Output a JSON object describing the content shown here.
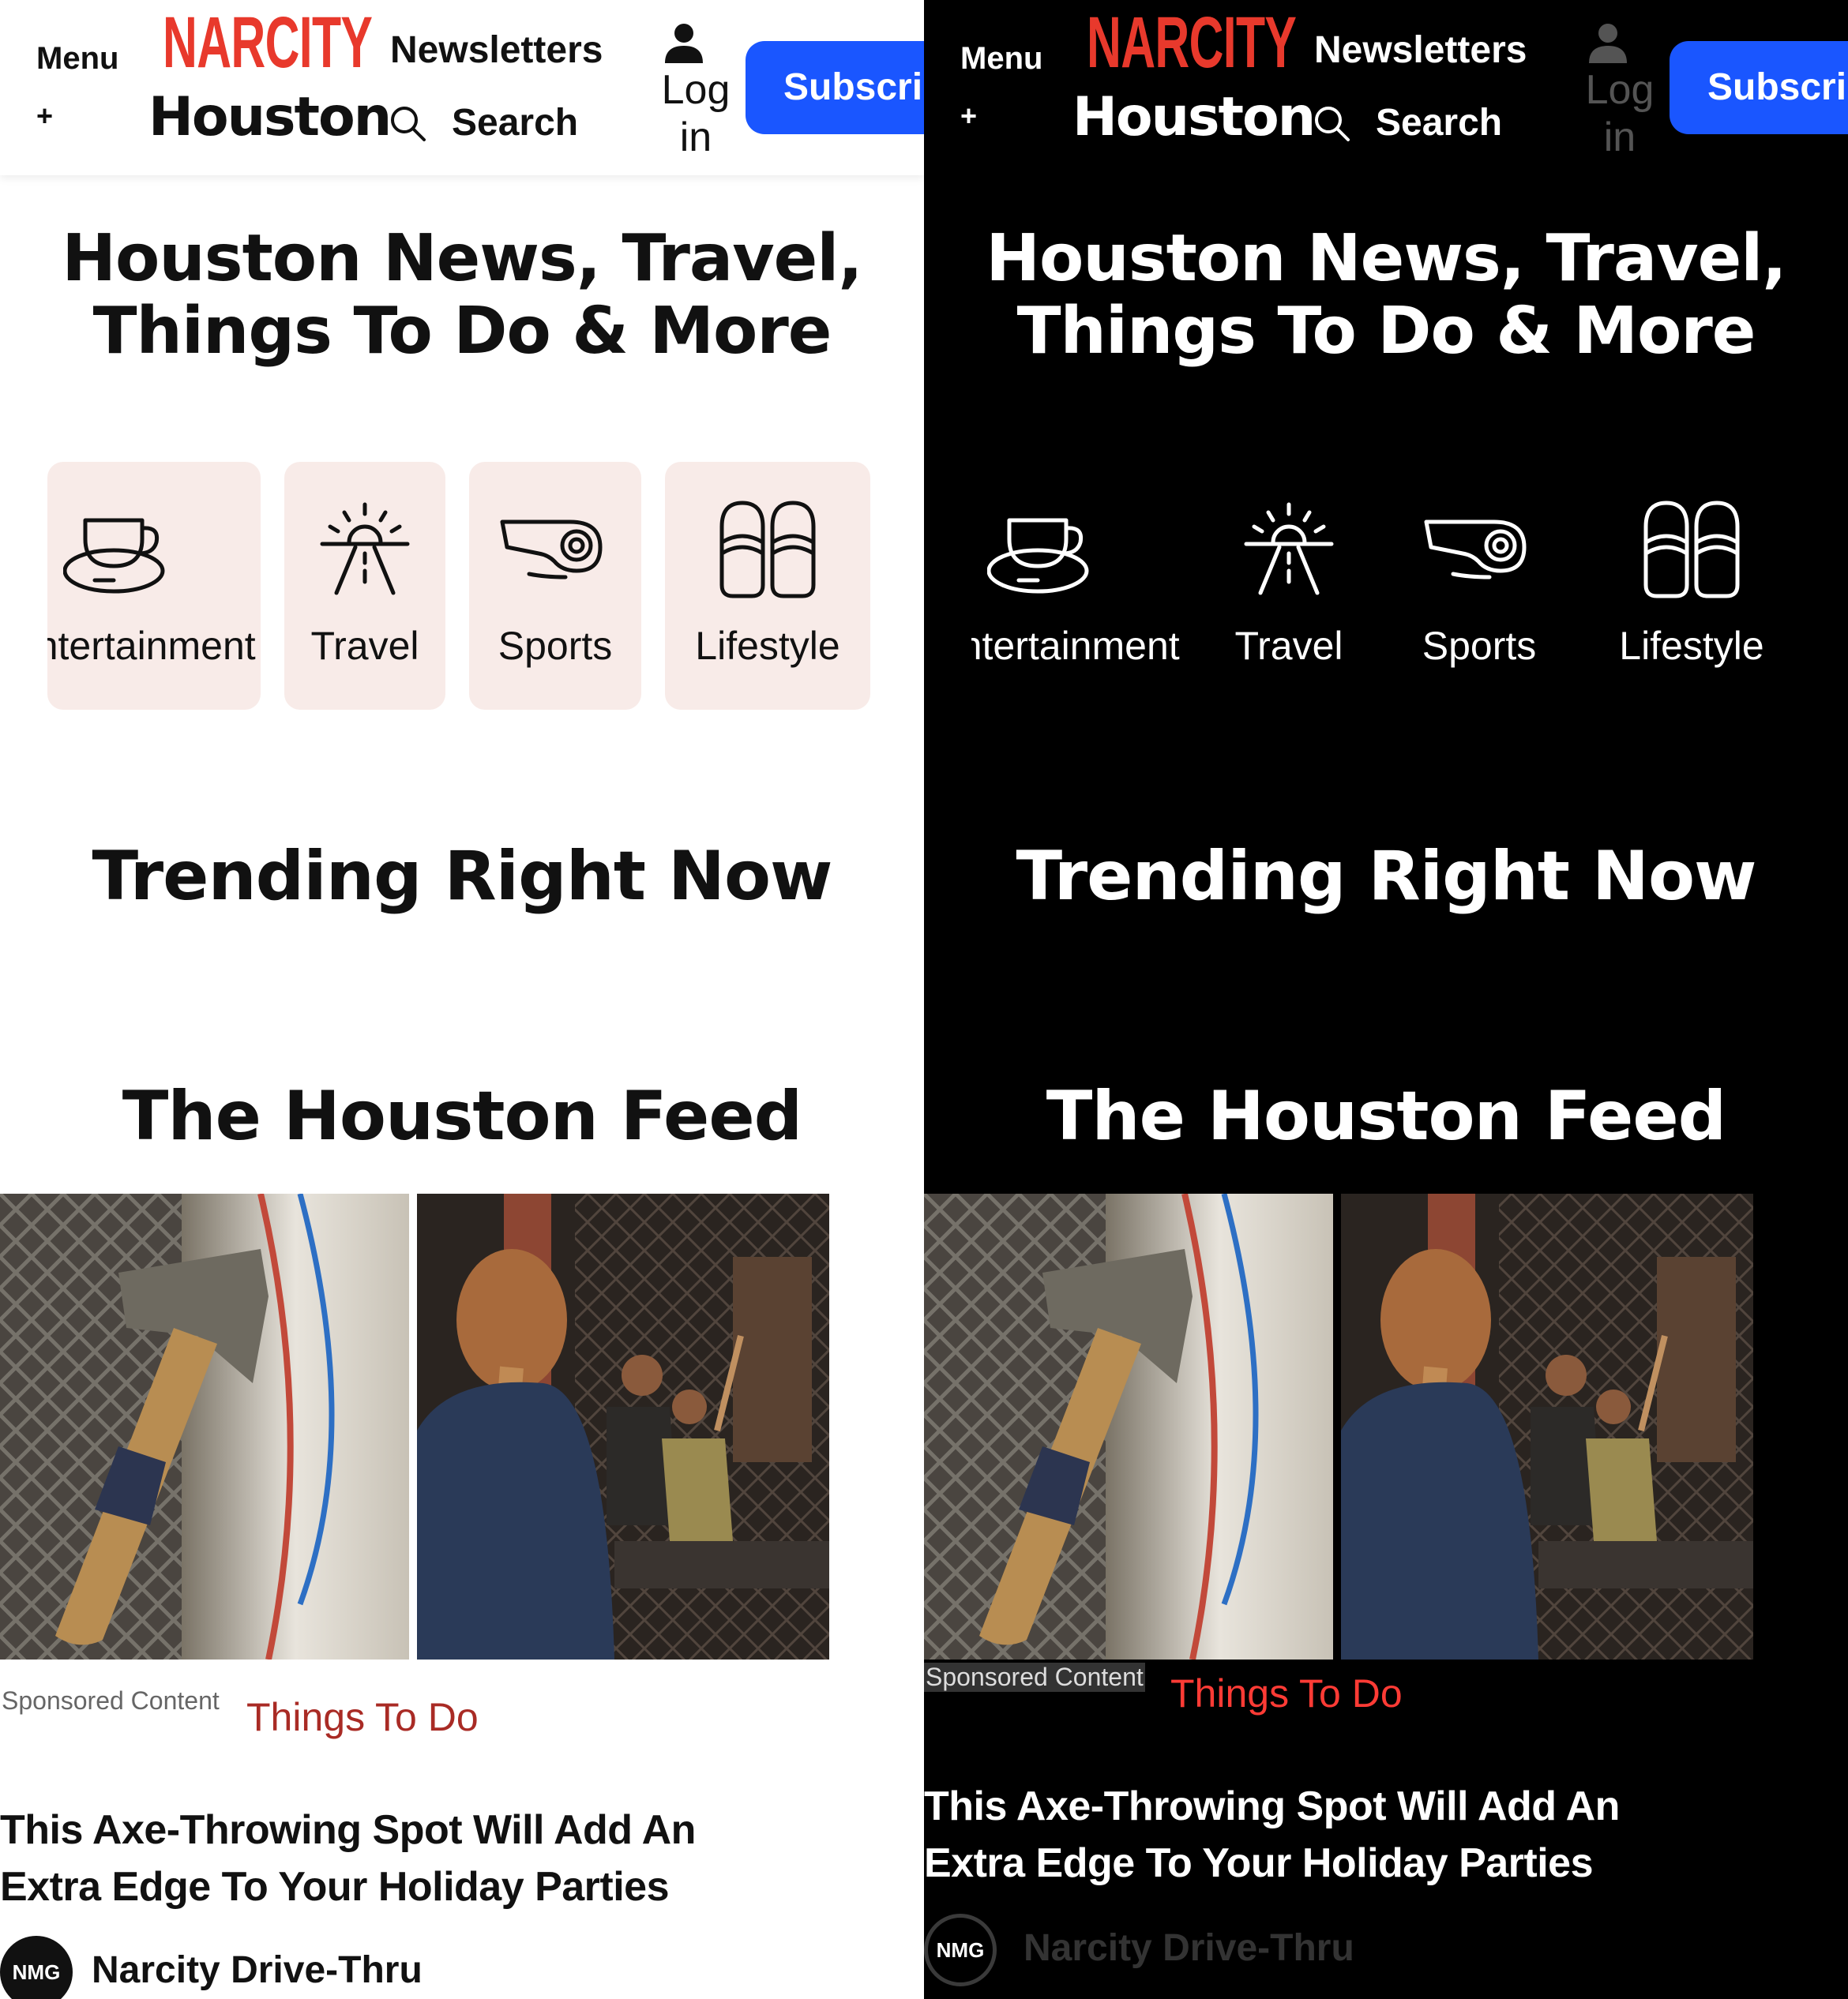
{
  "header": {
    "menu_label": "Menu",
    "menu_plus": "+",
    "brand": "NARCITY",
    "city": "Houston",
    "newsletters_label": "Newsletters",
    "search_label": "Search",
    "login_label": "Log in",
    "subscribe_label": "Subscribe"
  },
  "hero": {
    "title_line1": "Houston News, Travel,",
    "title_line2": "Things To Do & More"
  },
  "categories": [
    {
      "label": "Entertainment",
      "icon": "coffee-cup-icon"
    },
    {
      "label": "Travel",
      "icon": "sunrise-road-icon"
    },
    {
      "label": "Sports",
      "icon": "whistle-icon"
    },
    {
      "label": "Lifestyle",
      "icon": "slippers-icon"
    }
  ],
  "sections": {
    "trending_title": "Trending Right Now",
    "feed_title": "The Houston Feed"
  },
  "feed": {
    "sponsored_label": "Sponsored Content",
    "category_label": "Things To Do",
    "article_title": "This Axe-Throwing Spot Will Add An Extra Edge To Your Holiday Parties",
    "author_badge": "NMG",
    "author_name": "Narcity Drive-Thru"
  },
  "colors": {
    "brand_red": "#e8392c",
    "subscribe_blue": "#1a56ff",
    "category_tile_light": "#f8ebe8",
    "category_link_light": "#a92b25",
    "category_link_dark": "#ff3b35"
  },
  "themes": [
    "light",
    "dark"
  ]
}
